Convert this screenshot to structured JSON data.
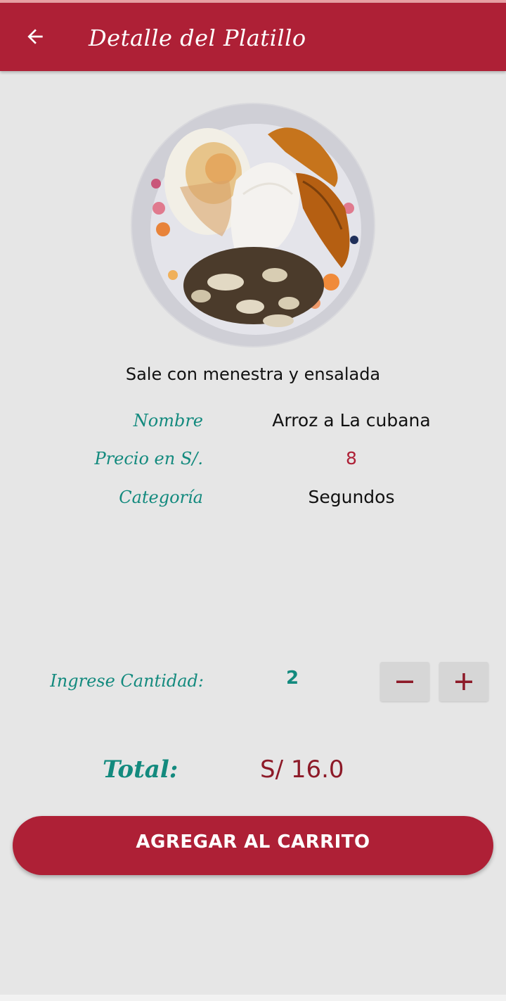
{
  "app_bar": {
    "title": "Detalle del Platillo",
    "back_icon": "arrow-left-icon",
    "color": "#ae2036"
  },
  "dish": {
    "image_alt": "Arroz a La cubana",
    "description": "Sale con menestra y ensalada",
    "fields": {
      "name_label": "Nombre",
      "name_value": "Arroz a La cubana",
      "price_label": "Precio en S/.",
      "price_value": "8",
      "category_label": "Categoría",
      "category_value": "Segundos"
    }
  },
  "quantity": {
    "label": "Ingrese Cantidad:",
    "value": "2",
    "decrement_icon": "minus-icon",
    "increment_icon": "plus-icon"
  },
  "total": {
    "label": "Total:",
    "value": "S/ 16.0"
  },
  "actions": {
    "add_to_cart_label": "AGREGAR AL CARRITO"
  },
  "colors": {
    "accent": "#ae2036",
    "label_teal": "#138a7e",
    "price_red": "#ae2036",
    "background": "#e6e6e6"
  }
}
